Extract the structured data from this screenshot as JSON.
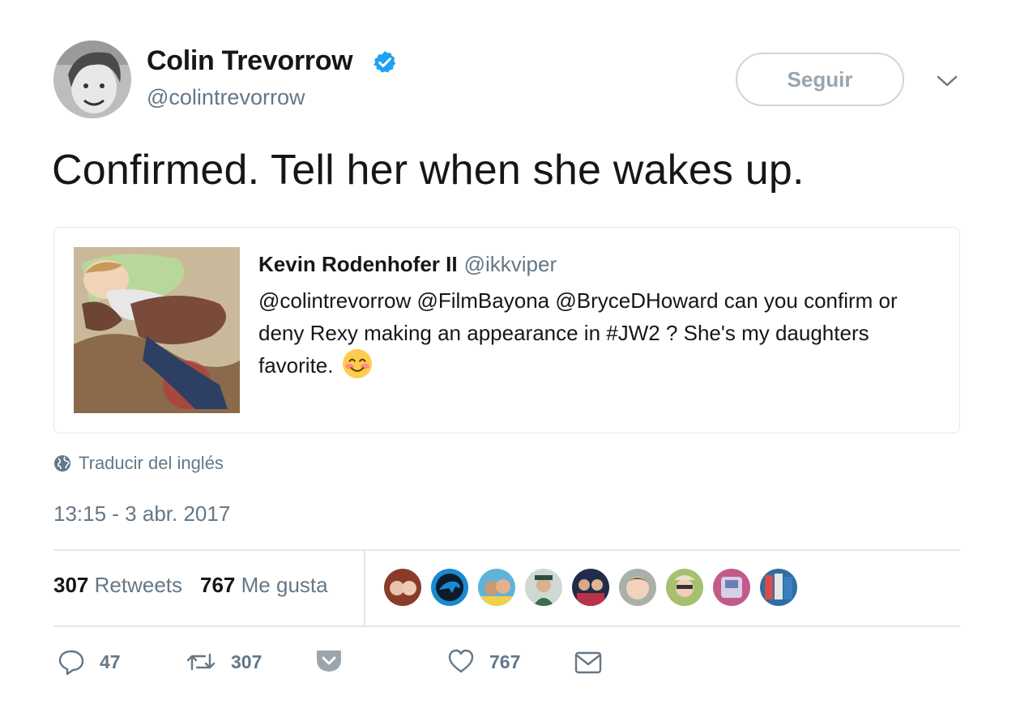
{
  "author": {
    "name": "Colin Trevorrow",
    "handle": "@colintrevorrow",
    "verified": true,
    "avatar_icon": "profile-photo"
  },
  "follow_label": "Seguir",
  "tweet_text": "Confirmed. Tell her when she wakes up.",
  "quoted": {
    "name": "Kevin Rodenhofer II",
    "handle": "@ikkviper",
    "text_lines": [
      "@colintrevorrow @FilmBayona @BryceDHoward can you confirm or",
      "deny Rexy making an appearance in #JW2 ? She's my daughters",
      "favorite."
    ],
    "emoji": "smiling-face-with-blush"
  },
  "translate_label": "Traducir del inglés",
  "timestamp": "13:15 - 3 abr. 2017",
  "stats": {
    "retweets_count": "307",
    "retweets_label": "Retweets",
    "likes_count": "767",
    "likes_label": "Me gusta"
  },
  "actions": {
    "reply_count": "47",
    "retweet_count": "307",
    "like_count": "767"
  },
  "colors": {
    "verified": "#1da1f2",
    "secondary_text": "#657786",
    "border": "#e1e8ed"
  }
}
